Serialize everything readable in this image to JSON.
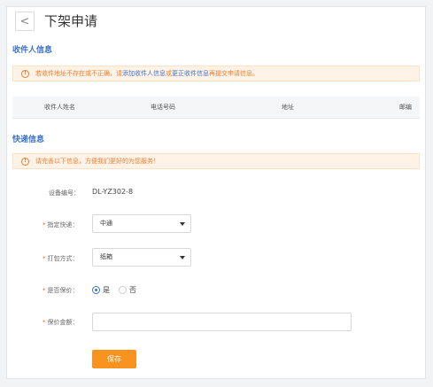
{
  "header": {
    "back_glyph": "<",
    "title": "下架申请"
  },
  "recipient": {
    "section_title": "收件人信息",
    "alert": {
      "icon_glyph": "!",
      "text_before": "若收件地址不存在或不正确，请 ",
      "add_link": "添加收件人信息",
      "or": " 或 ",
      "update_link": "更正收件信息",
      "text_after": " 再提交申请信息。"
    },
    "table_headers": [
      "收件人姓名",
      "电话号码",
      "地址",
      "邮编"
    ]
  },
  "express": {
    "section_title": "快递信息",
    "alert": {
      "icon_glyph": "!",
      "text": "请完善以下信息，方便我们更好的为您服务！"
    },
    "device": {
      "label": "设备编号：",
      "value": "DL-YZ302-8"
    },
    "courier": {
      "label": "指定快递：",
      "value": "中通"
    },
    "packing": {
      "label": "打包方式：",
      "value": "纸箱"
    },
    "insure": {
      "label": "是否保价：",
      "yes": "是",
      "no": "否",
      "selected": "是"
    },
    "insure_amount": {
      "label": "保价金额：",
      "value": ""
    },
    "save_label": "保存"
  },
  "colors": {
    "accent": "#3e73c7",
    "warning": "#f07c2b",
    "button": "#f7931e",
    "required": "#f06a24"
  }
}
